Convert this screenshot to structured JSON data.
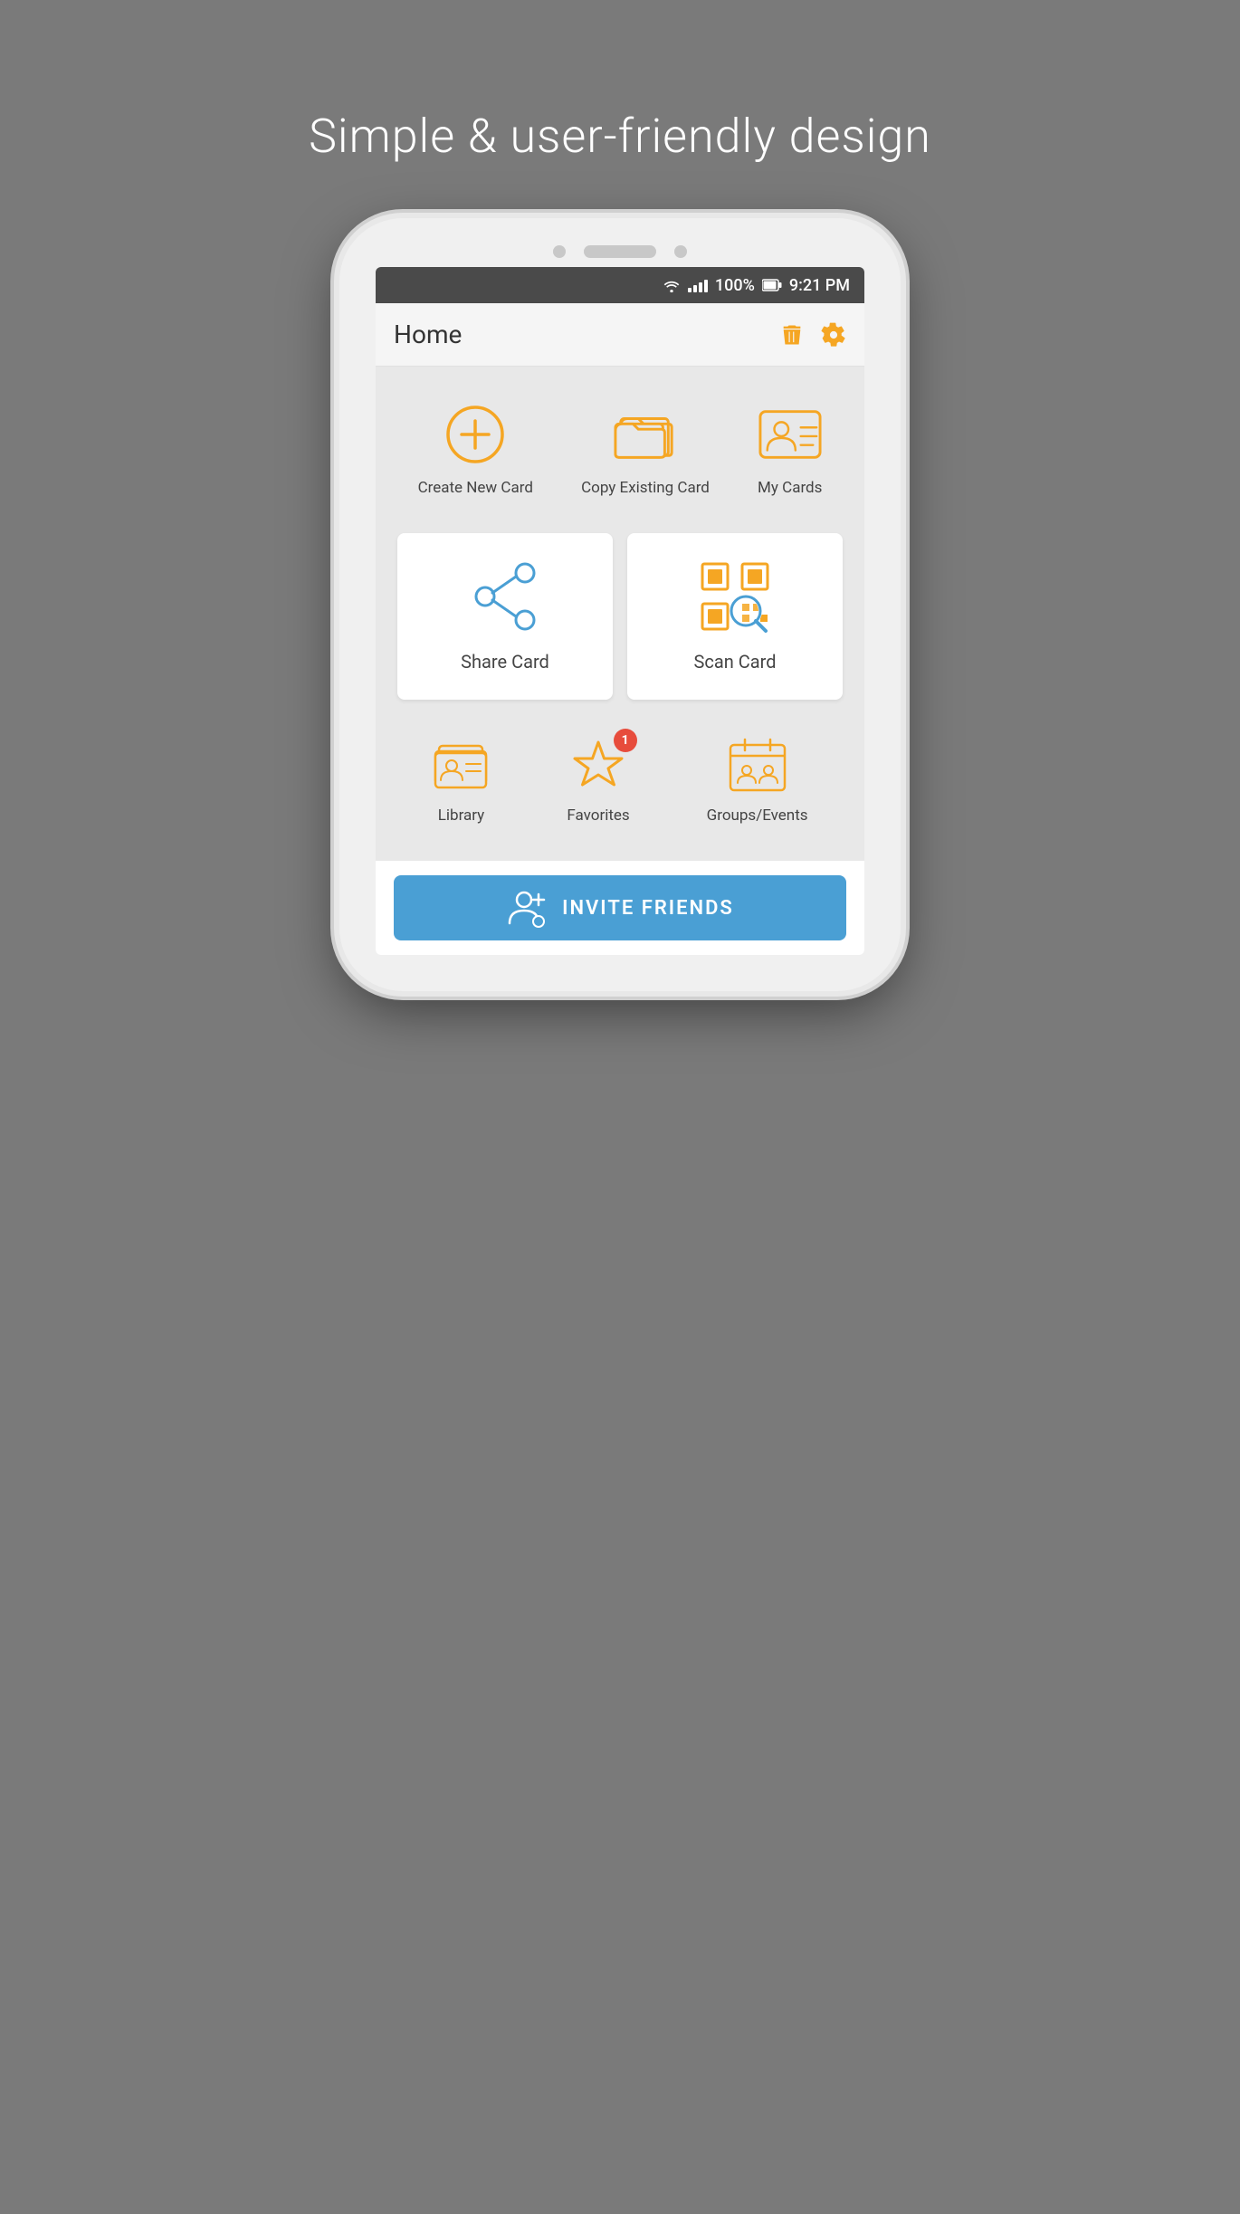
{
  "page": {
    "tagline": "Simple & user-friendly design",
    "background_color": "#7a7a7a"
  },
  "status_bar": {
    "wifi": "wifi",
    "signal": "signal",
    "battery": "100%",
    "time": "9:21 PM"
  },
  "app_bar": {
    "title": "Home",
    "delete_icon": "trash",
    "settings_icon": "gear"
  },
  "top_actions": [
    {
      "id": "create-new-card",
      "label": "Create New Card",
      "icon": "circle-plus"
    },
    {
      "id": "copy-existing-card",
      "label": "Copy Existing Card",
      "icon": "folder"
    },
    {
      "id": "my-cards",
      "label": "My Cards",
      "icon": "card-list"
    }
  ],
  "card_actions": [
    {
      "id": "share-card",
      "label": "Share Card",
      "icon": "share"
    },
    {
      "id": "scan-card",
      "label": "Scan Card",
      "icon": "qr-scan"
    }
  ],
  "bottom_icons": [
    {
      "id": "library",
      "label": "Library",
      "icon": "library",
      "badge": null
    },
    {
      "id": "favorites",
      "label": "Favorites",
      "icon": "star",
      "badge": "1"
    },
    {
      "id": "groups-events",
      "label": "Groups/Events",
      "icon": "groups",
      "badge": null
    }
  ],
  "invite": {
    "label": "INVITE FRIENDS",
    "icon": "person-add",
    "bg_color": "#4a9fd4"
  },
  "colors": {
    "orange": "#f5a623",
    "blue": "#4a9fd4",
    "red": "#e74c3c",
    "white": "#ffffff",
    "text_dark": "#444444",
    "status_bar": "#4a4a4a",
    "app_bar": "#f5f5f5"
  }
}
